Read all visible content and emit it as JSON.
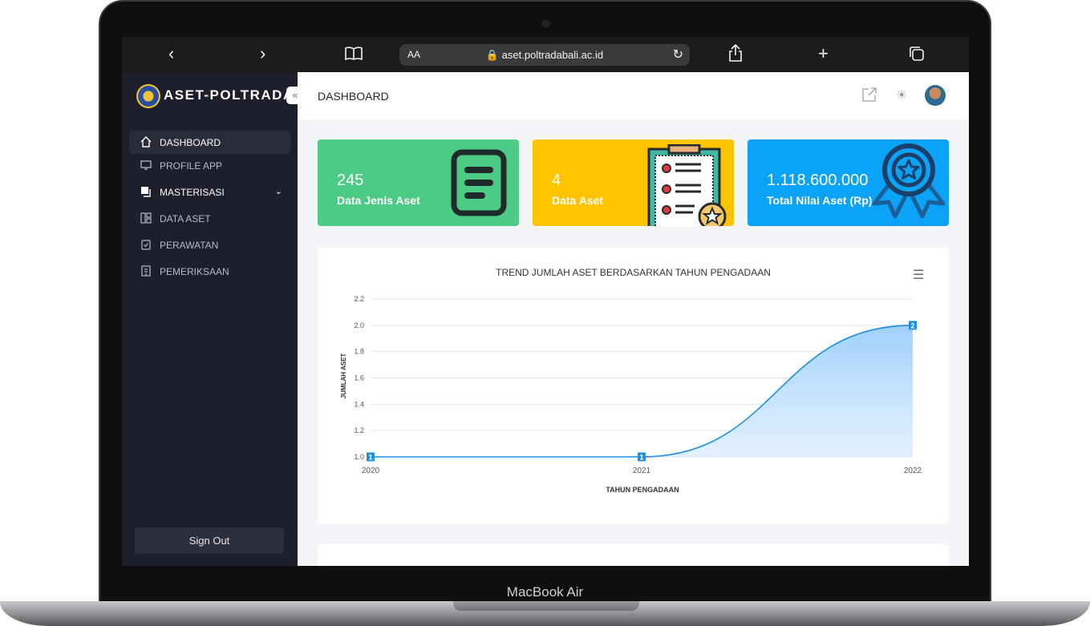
{
  "browser": {
    "url": "aset.poltradabali.ac.id",
    "text_size_label": "AA"
  },
  "sidebar": {
    "app_name": "ASET-POLTRADA",
    "items": [
      {
        "label": "DASHBOARD",
        "icon": "home-icon"
      },
      {
        "label": "PROFILE APP",
        "icon": "monitor-icon"
      },
      {
        "label": "MASTERISASI",
        "icon": "copy-icon"
      },
      {
        "label": "DATA ASET",
        "icon": "layout-icon"
      },
      {
        "label": "PERAWATAN",
        "icon": "clipboard-check-icon"
      },
      {
        "label": "PEMERIKSAAN",
        "icon": "building-icon"
      }
    ],
    "sign_out": "Sign Out"
  },
  "header": {
    "title": "DASHBOARD"
  },
  "cards": [
    {
      "value": "245",
      "label": "Data Jenis Aset",
      "color": "#4ccb87",
      "icon": "document-icon"
    },
    {
      "value": "4",
      "label": "Data Aset",
      "color": "#ffc400",
      "icon": "clipboard-list-icon"
    },
    {
      "value": "1.118.600.000",
      "label": "Total Nilai Aset (Rp)",
      "color": "#0ba3f7",
      "icon": "award-icon"
    }
  ],
  "chart_data": {
    "type": "area",
    "title": "TREND JUMLAH ASET BERDASARKAN TAHUN PENGADAAN",
    "xlabel": "TAHUN PENGADAAN",
    "ylabel": "JUMLAH ASET",
    "categories": [
      "2020",
      "2021",
      "2022"
    ],
    "values": [
      1,
      1,
      2
    ],
    "data_labels": [
      "1",
      "1",
      "2"
    ],
    "ylim": [
      1.0,
      2.2
    ],
    "yticks": [
      "1.0",
      "1.2",
      "1.4",
      "1.6",
      "1.8",
      "2.0",
      "2.2"
    ],
    "grid": true,
    "color": "#1e8fe6"
  },
  "device": {
    "label": "MacBook Air"
  }
}
